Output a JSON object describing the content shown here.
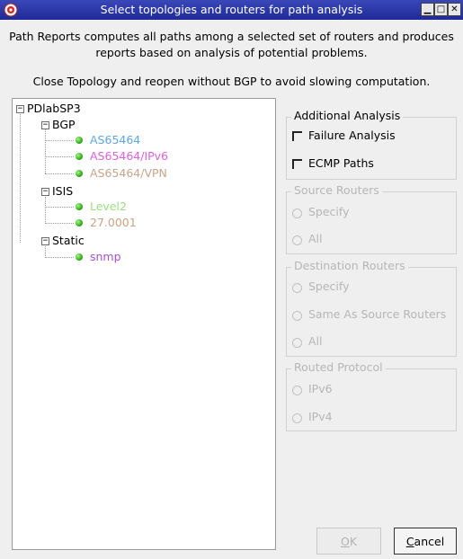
{
  "window": {
    "title": "Select topologies and routers for path analysis",
    "minimize_glyph": "▁",
    "maximize_glyph": "□",
    "close_glyph": "✕"
  },
  "description": {
    "line1": "Path Reports computes all paths among a selected set of routers and produces",
    "line2": "reports based on analysis of potential problems.",
    "note": "Close Topology and reopen without BGP to avoid slowing computation."
  },
  "tree": {
    "root": "PDlabSP3",
    "groups": [
      {
        "label": "BGP",
        "children": [
          {
            "label": "AS65464",
            "color": "#5aa8e8"
          },
          {
            "label": "AS65464/IPv6",
            "color": "#e060e0"
          },
          {
            "label": "AS65464/VPN",
            "color": "#c9a38a"
          }
        ]
      },
      {
        "label": "ISIS",
        "children": [
          {
            "label": "Level2",
            "color": "#9be07a"
          },
          {
            "label": "27.0001",
            "color": "#d0a080"
          }
        ]
      },
      {
        "label": "Static",
        "children": [
          {
            "label": "snmp",
            "color": "#a64ed8"
          }
        ]
      }
    ],
    "expander_glyph": "−"
  },
  "additional_analysis": {
    "title": "Additional Analysis",
    "failure_label": "Failure Analysis",
    "ecmp_label": "ECMP Paths"
  },
  "source_routers": {
    "title": "Source Routers",
    "specify": "Specify",
    "all": "All"
  },
  "destination_routers": {
    "title": "Destination Routers",
    "specify": "Specify",
    "same": "Same As Source Routers",
    "all": "All"
  },
  "routed_protocol": {
    "title": "Routed Protocol",
    "ipv6": "IPv6",
    "ipv4": "IPv4"
  },
  "buttons": {
    "ok_mnemonic": "O",
    "ok_rest": "K",
    "cancel_mnemonic": "C",
    "cancel_rest": "ancel"
  }
}
